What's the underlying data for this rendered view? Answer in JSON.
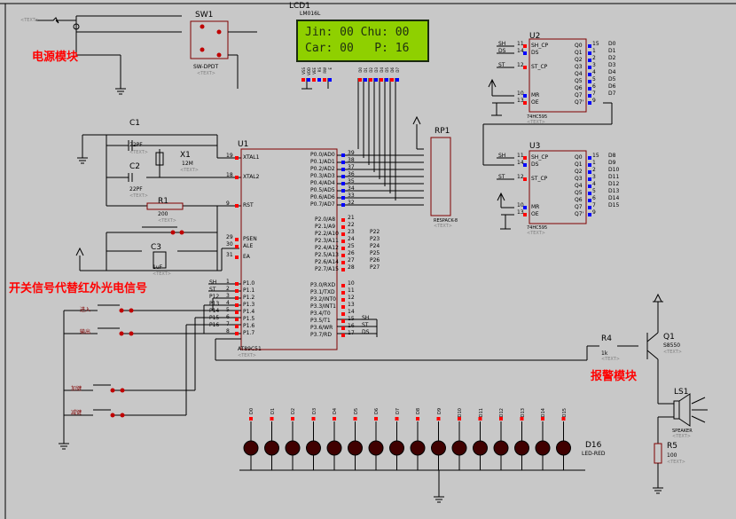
{
  "modules": {
    "power": "电源模块",
    "switch_signal": "开关信号代替红外光电信号",
    "alarm": "报警模块"
  },
  "text_placeholder": "<TEXT>",
  "lcd": {
    "ref": "LCD1",
    "part": "LM016L",
    "line1": "Jin: 00 Chu: 00",
    "line2": "Car: 00   P: 16",
    "pins": [
      "VSS",
      "VDD",
      "VEE",
      "RS",
      "RW",
      "E",
      "D0",
      "D1",
      "D2",
      "D3",
      "D4",
      "D5",
      "D6",
      "D7"
    ]
  },
  "sw1": {
    "ref": "SW1",
    "part": "SW-DPDT"
  },
  "c1": {
    "ref": "C1",
    "value": "22PF"
  },
  "c2": {
    "ref": "C2",
    "value": "22PF"
  },
  "c3": {
    "ref": "C3",
    "value": "1uF"
  },
  "x1": {
    "ref": "X1",
    "value": "12M"
  },
  "r1": {
    "ref": "R1",
    "value": "200"
  },
  "rp1": {
    "ref": "RP1",
    "part": "RESPACK-8"
  },
  "u1": {
    "ref": "U1",
    "part": "AT89C51",
    "left_pins": [
      {
        "num": "19",
        "name": "XTAL1"
      },
      {
        "num": "18",
        "name": "XTAL2"
      },
      {
        "num": "9",
        "name": "RST"
      },
      {
        "num": "29",
        "name": "PSEN"
      },
      {
        "num": "30",
        "name": "ALE"
      },
      {
        "num": "31",
        "name": "EA"
      },
      {
        "num": "1",
        "name": "P1.0"
      },
      {
        "num": "2",
        "name": "P1.1"
      },
      {
        "num": "3",
        "name": "P1.2"
      },
      {
        "num": "4",
        "name": "P1.3"
      },
      {
        "num": "5",
        "name": "P1.4"
      },
      {
        "num": "6",
        "name": "P1.5"
      },
      {
        "num": "7",
        "name": "P1.6"
      },
      {
        "num": "8",
        "name": "P1.7"
      }
    ],
    "p0_pins": [
      {
        "num": "39",
        "name": "P0.0/AD0"
      },
      {
        "num": "38",
        "name": "P0.1/AD1"
      },
      {
        "num": "37",
        "name": "P0.2/AD2"
      },
      {
        "num": "36",
        "name": "P0.3/AD3"
      },
      {
        "num": "35",
        "name": "P0.4/AD4"
      },
      {
        "num": "34",
        "name": "P0.5/AD5"
      },
      {
        "num": "33",
        "name": "P0.6/AD6"
      },
      {
        "num": "32",
        "name": "P0.7/AD7"
      }
    ],
    "p2_pins": [
      {
        "num": "21",
        "name": "P2.0/A8"
      },
      {
        "num": "22",
        "name": "P2.1/A9"
      },
      {
        "num": "23",
        "name": "P2.2/A10"
      },
      {
        "num": "24",
        "name": "P2.3/A11"
      },
      {
        "num": "25",
        "name": "P2.4/A12"
      },
      {
        "num": "26",
        "name": "P2.5/A13"
      },
      {
        "num": "27",
        "name": "P2.6/A14"
      },
      {
        "num": "28",
        "name": "P2.7/A15"
      }
    ],
    "p3_pins": [
      {
        "num": "10",
        "name": "P3.0/RXD"
      },
      {
        "num": "11",
        "name": "P3.1/TXD"
      },
      {
        "num": "12",
        "name": "P3.2/INT0"
      },
      {
        "num": "13",
        "name": "P3.3/INT1"
      },
      {
        "num": "14",
        "name": "P3.4/T0"
      },
      {
        "num": "15",
        "name": "P3.5/T1"
      },
      {
        "num": "16",
        "name": "P3.6/WR"
      },
      {
        "num": "17",
        "name": "P3.7/RD"
      }
    ],
    "p2_nets": [
      "P22",
      "P23",
      "P24",
      "P25",
      "P26",
      "P27"
    ],
    "p3_nets": [
      "SH",
      "ST",
      "DS"
    ],
    "p1_nets": [
      "SH",
      "ST",
      "P12",
      "P13",
      "P14",
      "P15",
      "P16"
    ]
  },
  "u2": {
    "ref": "U2",
    "part": "74HC595",
    "left": [
      {
        "num": "11",
        "name": "SH_CP",
        "net": "SH"
      },
      {
        "num": "14",
        "name": "DS",
        "net": "DS"
      },
      {
        "num": "12",
        "name": "ST_CP",
        "net": "ST"
      },
      {
        "num": "10",
        "name": "MR",
        "net": ""
      },
      {
        "num": "13",
        "name": "OE",
        "net": ""
      }
    ],
    "right": [
      {
        "num": "15",
        "name": "Q0",
        "net": "D0"
      },
      {
        "num": "1",
        "name": "Q1",
        "net": "D1"
      },
      {
        "num": "2",
        "name": "Q2",
        "net": "D2"
      },
      {
        "num": "3",
        "name": "Q3",
        "net": "D3"
      },
      {
        "num": "4",
        "name": "Q4",
        "net": "D4"
      },
      {
        "num": "5",
        "name": "Q5",
        "net": "D5"
      },
      {
        "num": "6",
        "name": "Q6",
        "net": "D6"
      },
      {
        "num": "7",
        "name": "Q7",
        "net": "D7"
      },
      {
        "num": "9",
        "name": "Q7'",
        "net": ""
      }
    ]
  },
  "u3": {
    "ref": "U3",
    "part": "74HC595",
    "left": [
      {
        "num": "11",
        "name": "SH_CP",
        "net": "SH"
      },
      {
        "num": "14",
        "name": "DS",
        "net": ""
      },
      {
        "num": "12",
        "name": "ST_CP",
        "net": "ST"
      },
      {
        "num": "10",
        "name": "MR",
        "net": ""
      },
      {
        "num": "13",
        "name": "OE",
        "net": ""
      }
    ],
    "right": [
      {
        "num": "15",
        "name": "Q0",
        "net": "D8"
      },
      {
        "num": "1",
        "name": "Q1",
        "net": "D9"
      },
      {
        "num": "2",
        "name": "Q2",
        "net": "D10"
      },
      {
        "num": "3",
        "name": "Q3",
        "net": "D11"
      },
      {
        "num": "4",
        "name": "Q4",
        "net": "D12"
      },
      {
        "num": "5",
        "name": "Q5",
        "net": "D13"
      },
      {
        "num": "6",
        "name": "Q6",
        "net": "D14"
      },
      {
        "num": "7",
        "name": "Q7",
        "net": "D15"
      },
      {
        "num": "9",
        "name": "Q7'",
        "net": ""
      }
    ]
  },
  "buttons": {
    "in": "进入",
    "out": "输出",
    "add": "加键",
    "sub": "减键"
  },
  "r4": {
    "ref": "R4",
    "value": "1k"
  },
  "r5": {
    "ref": "R5",
    "value": "100"
  },
  "q1": {
    "ref": "Q1",
    "part": "S8550"
  },
  "ls1": {
    "ref": "LS1",
    "part": "SPEAKER"
  },
  "leds": {
    "ref": "D16",
    "part": "LED-RED",
    "nets": [
      "D0",
      "D1",
      "D2",
      "D3",
      "D4",
      "D5",
      "D6",
      "D7",
      "D8",
      "D9",
      "D10",
      "D11",
      "D12",
      "D13",
      "D14",
      "D15"
    ]
  },
  "colors": {
    "background": "#c8c8c8",
    "wire": "#000000",
    "part_fill": "#ffffc8",
    "part_border": "#800000",
    "lcd_bg": "#8fd000",
    "label_red": "#ff0000",
    "pin_red": "#ff0000",
    "pin_blue": "#0000ff",
    "led_body": "#400000"
  }
}
